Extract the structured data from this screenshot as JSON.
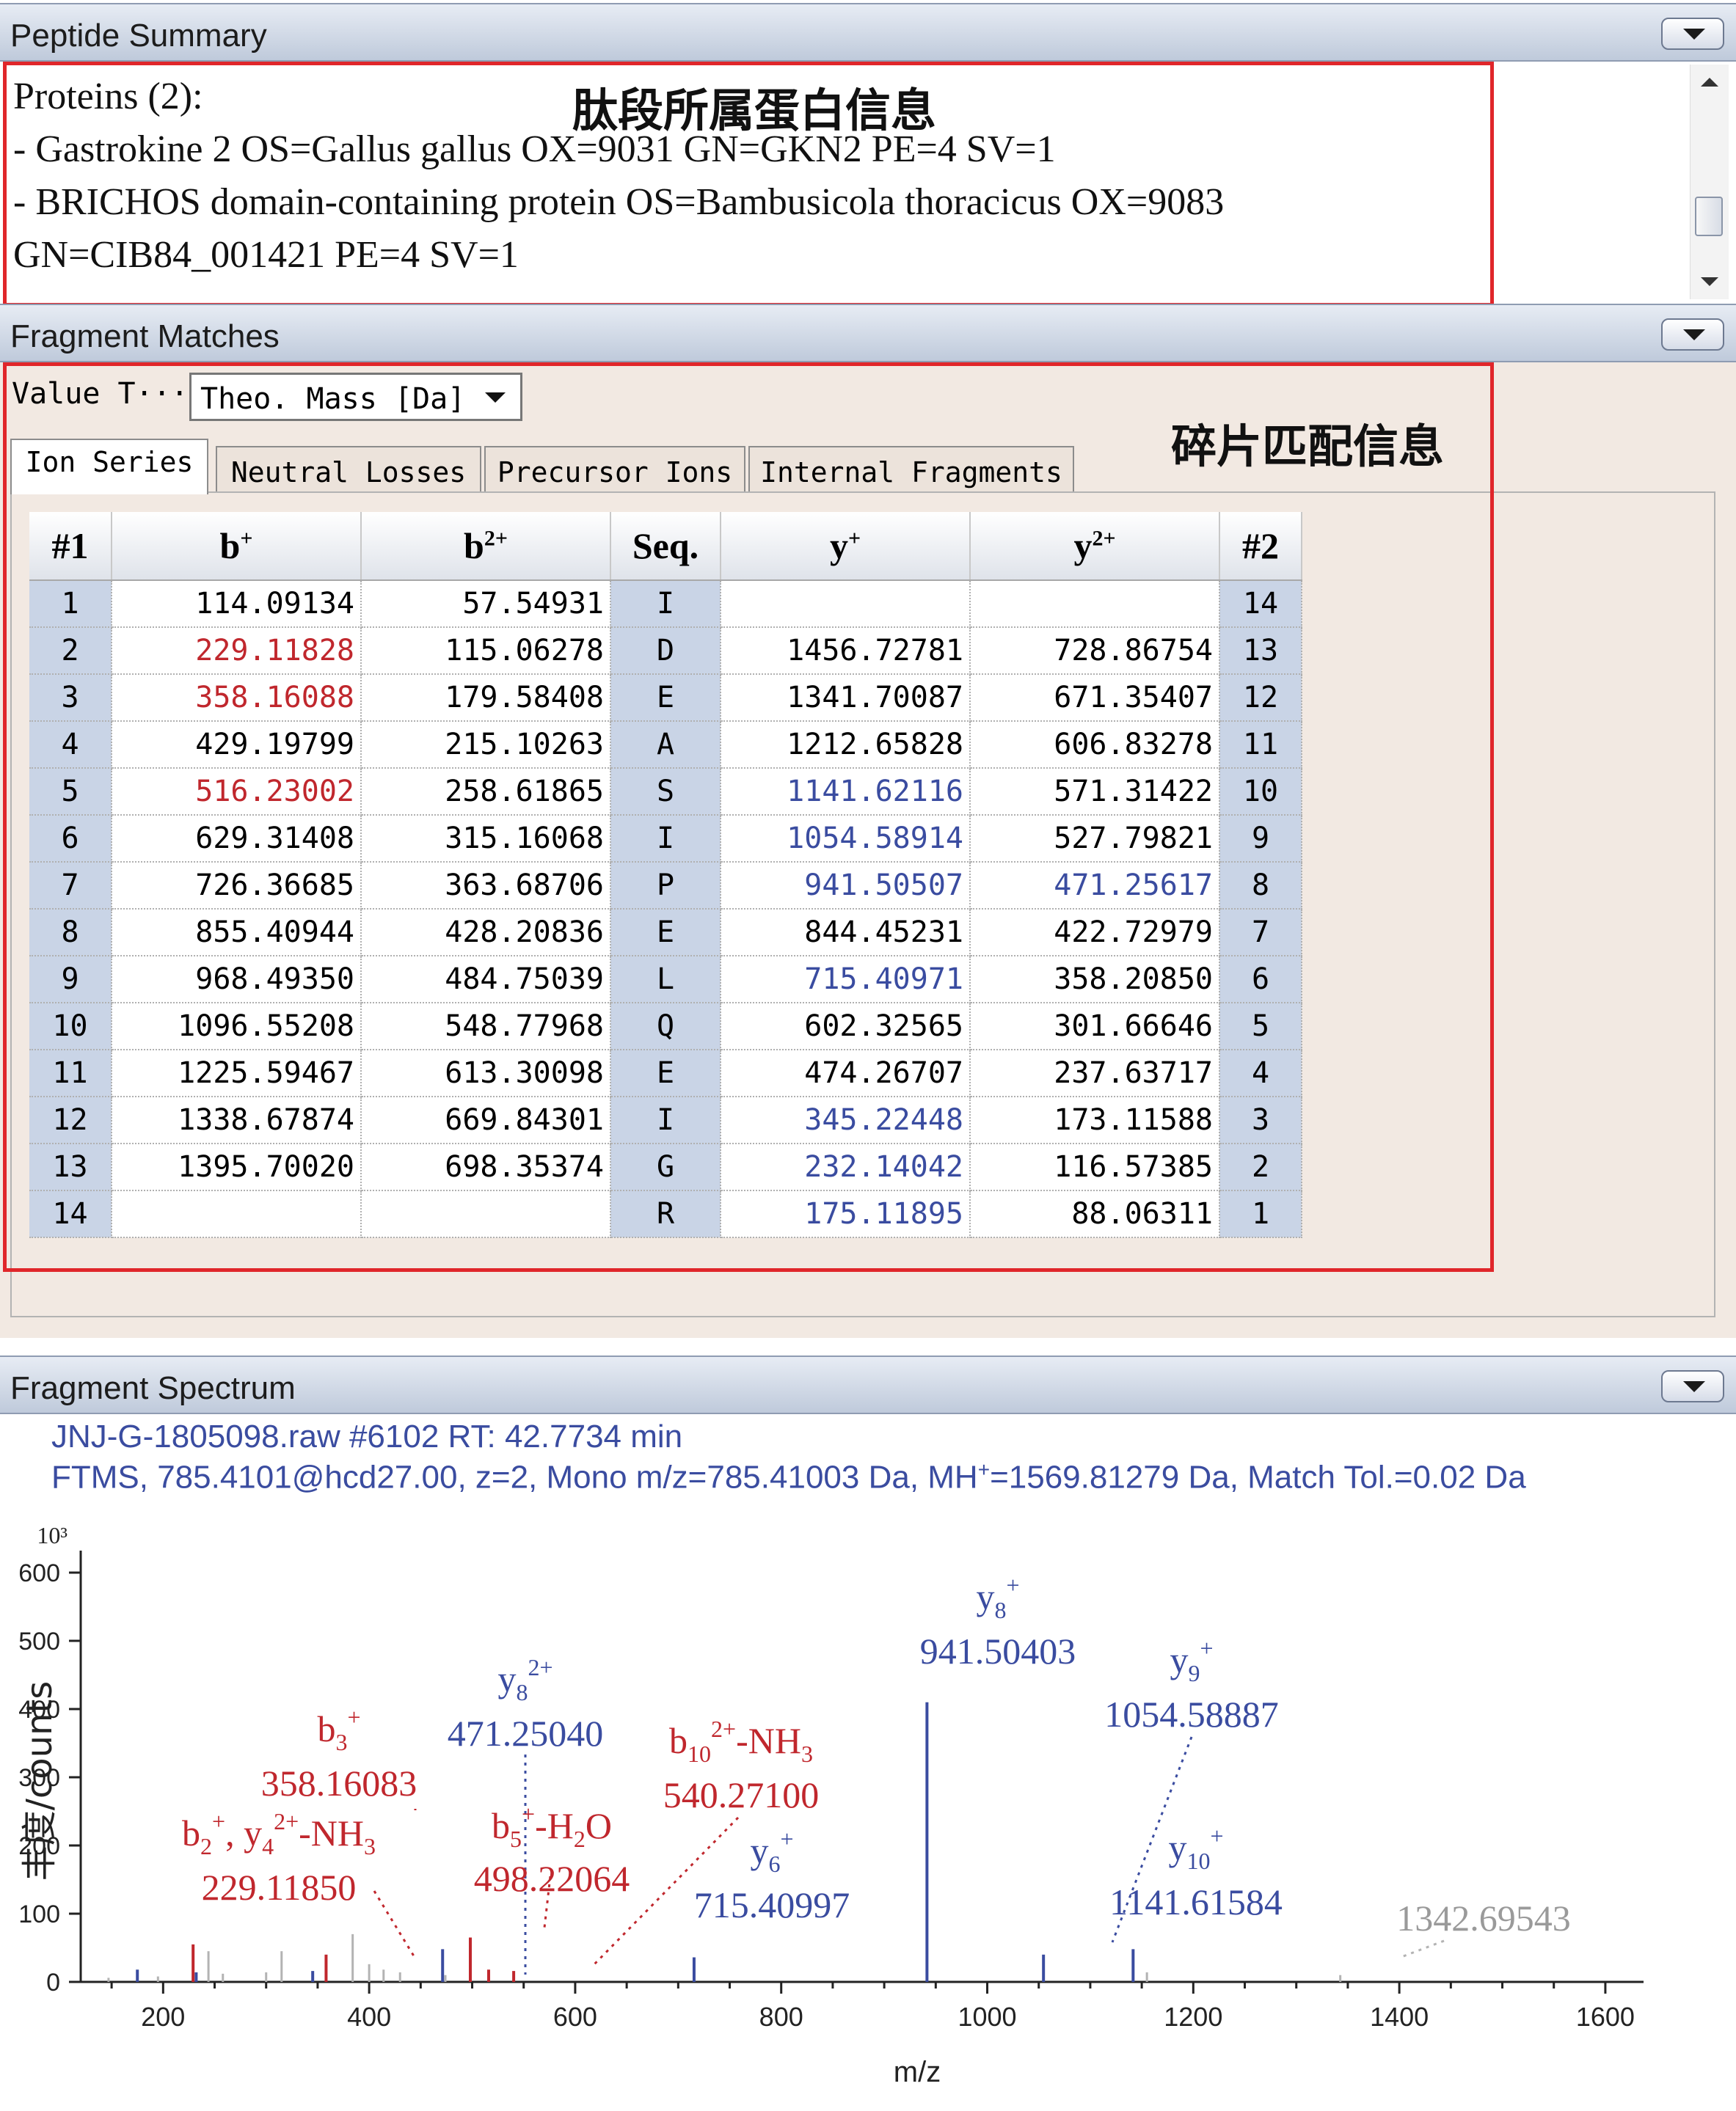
{
  "panels": {
    "summary_title": "Peptide Summary",
    "matches_title": "Fragment Matches",
    "spectrum_title": "Fragment Spectrum"
  },
  "summary": {
    "proteins_header": "Proteins (2):",
    "protein_1": "- Gastrokine 2 OS=Gallus gallus OX=9031 GN=GKN2 PE=4 SV=1",
    "protein_2a": "- BRICHOS domain-containing protein OS=Bambusicola thoracicus OX=9083",
    "protein_2b": "GN=CIB84_001421 PE=4 SV=1",
    "annotation": "肽段所属蛋白信息"
  },
  "matches": {
    "value_type_label": "Value T···",
    "value_type_selected": "Theo. Mass [Da]",
    "annotation": "碎片匹配信息",
    "tabs": [
      "Ion Series",
      "Neutral Losses",
      "Precursor Ions",
      "Internal Fragments"
    ],
    "headers": {
      "n1": "#1",
      "b": "b",
      "b_sup": "+",
      "b2": "b",
      "b2_sup": "2+",
      "seq": "Seq.",
      "y": "y",
      "y_sup": "+",
      "y2": "y",
      "y2_sup": "2+",
      "n2": "#2"
    },
    "rows": [
      {
        "n1": "1",
        "b": "114.09134",
        "b2": "57.54931",
        "seq": "I",
        "y": "",
        "y2": "",
        "n2": "14",
        "bc": "",
        "yc": "",
        "y2c": ""
      },
      {
        "n1": "2",
        "b": "229.11828",
        "b2": "115.06278",
        "seq": "D",
        "y": "1456.72781",
        "y2": "728.86754",
        "n2": "13",
        "bc": "red",
        "yc": "",
        "y2c": ""
      },
      {
        "n1": "3",
        "b": "358.16088",
        "b2": "179.58408",
        "seq": "E",
        "y": "1341.70087",
        "y2": "671.35407",
        "n2": "12",
        "bc": "red",
        "yc": "",
        "y2c": ""
      },
      {
        "n1": "4",
        "b": "429.19799",
        "b2": "215.10263",
        "seq": "A",
        "y": "1212.65828",
        "y2": "606.83278",
        "n2": "11",
        "bc": "",
        "yc": "",
        "y2c": ""
      },
      {
        "n1": "5",
        "b": "516.23002",
        "b2": "258.61865",
        "seq": "S",
        "y": "1141.62116",
        "y2": "571.31422",
        "n2": "10",
        "bc": "red",
        "yc": "blue",
        "y2c": ""
      },
      {
        "n1": "6",
        "b": "629.31408",
        "b2": "315.16068",
        "seq": "I",
        "y": "1054.58914",
        "y2": "527.79821",
        "n2": "9",
        "bc": "",
        "yc": "blue",
        "y2c": ""
      },
      {
        "n1": "7",
        "b": "726.36685",
        "b2": "363.68706",
        "seq": "P",
        "y": "941.50507",
        "y2": "471.25617",
        "n2": "8",
        "bc": "",
        "yc": "blue",
        "y2c": "blue"
      },
      {
        "n1": "8",
        "b": "855.40944",
        "b2": "428.20836",
        "seq": "E",
        "y": "844.45231",
        "y2": "422.72979",
        "n2": "7",
        "bc": "",
        "yc": "",
        "y2c": ""
      },
      {
        "n1": "9",
        "b": "968.49350",
        "b2": "484.75039",
        "seq": "L",
        "y": "715.40971",
        "y2": "358.20850",
        "n2": "6",
        "bc": "",
        "yc": "blue",
        "y2c": ""
      },
      {
        "n1": "10",
        "b": "1096.55208",
        "b2": "548.77968",
        "seq": "Q",
        "y": "602.32565",
        "y2": "301.66646",
        "n2": "5",
        "bc": "",
        "yc": "",
        "y2c": ""
      },
      {
        "n1": "11",
        "b": "1225.59467",
        "b2": "613.30098",
        "seq": "E",
        "y": "474.26707",
        "y2": "237.63717",
        "n2": "4",
        "bc": "",
        "yc": "",
        "y2c": ""
      },
      {
        "n1": "12",
        "b": "1338.67874",
        "b2": "669.84301",
        "seq": "I",
        "y": "345.22448",
        "y2": "173.11588",
        "n2": "3",
        "bc": "",
        "yc": "blue",
        "y2c": ""
      },
      {
        "n1": "13",
        "b": "1395.70020",
        "b2": "698.35374",
        "seq": "G",
        "y": "232.14042",
        "y2": "116.57385",
        "n2": "2",
        "bc": "",
        "yc": "blue",
        "y2c": ""
      },
      {
        "n1": "14",
        "b": "",
        "b2": "",
        "seq": "R",
        "y": "175.11895",
        "y2": "88.06311",
        "n2": "1",
        "bc": "",
        "yc": "blue",
        "y2c": ""
      }
    ]
  },
  "spectrum": {
    "info_line1": "JNJ-G-1805098.raw  #6102  RT: 42.7734 min",
    "info_line2_a": "FTMS, 785.4101@hcd27.00, z=2, Mono m/z=785.41003 Da, MH",
    "info_line2_sup": "+",
    "info_line2_b": "=1569.81279 Da, Match Tol.=0.02 Da",
    "exponent_label": "10³"
  },
  "chart_data": {
    "type": "bar",
    "xlabel": "m/z",
    "ylabel": "丰度/counts",
    "xlim": [
      120,
      1620
    ],
    "ylim": [
      0,
      600
    ],
    "xticks": [
      200,
      400,
      600,
      800,
      1000,
      1200,
      1400,
      1600
    ],
    "yticks": [
      0,
      100,
      200,
      300,
      400,
      500,
      600
    ],
    "colors": {
      "b_ions": "#c0272d",
      "y_ions": "#3a4ca0",
      "unmatched": "#b3b3b3"
    },
    "peaks": [
      {
        "mz": 147,
        "intensity": 6,
        "kind": "gray"
      },
      {
        "mz": 175,
        "intensity": 18,
        "kind": "blue"
      },
      {
        "mz": 195,
        "intensity": 8,
        "kind": "gray"
      },
      {
        "mz": 229.1,
        "intensity": 55,
        "kind": "red"
      },
      {
        "mz": 232.1,
        "intensity": 14,
        "kind": "blue"
      },
      {
        "mz": 244,
        "intensity": 45,
        "kind": "gray"
      },
      {
        "mz": 258,
        "intensity": 12,
        "kind": "gray"
      },
      {
        "mz": 300,
        "intensity": 14,
        "kind": "gray"
      },
      {
        "mz": 315,
        "intensity": 45,
        "kind": "gray"
      },
      {
        "mz": 345.2,
        "intensity": 16,
        "kind": "blue"
      },
      {
        "mz": 358.2,
        "intensity": 40,
        "kind": "red"
      },
      {
        "mz": 384,
        "intensity": 70,
        "kind": "gray"
      },
      {
        "mz": 400,
        "intensity": 26,
        "kind": "gray"
      },
      {
        "mz": 414,
        "intensity": 18,
        "kind": "gray"
      },
      {
        "mz": 430,
        "intensity": 14,
        "kind": "gray"
      },
      {
        "mz": 471.3,
        "intensity": 48,
        "kind": "blue"
      },
      {
        "mz": 474,
        "intensity": 10,
        "kind": "gray"
      },
      {
        "mz": 498.2,
        "intensity": 65,
        "kind": "red"
      },
      {
        "mz": 516,
        "intensity": 18,
        "kind": "red"
      },
      {
        "mz": 540.3,
        "intensity": 16,
        "kind": "red"
      },
      {
        "mz": 715.4,
        "intensity": 36,
        "kind": "blue"
      },
      {
        "mz": 941.5,
        "intensity": 410,
        "kind": "blue"
      },
      {
        "mz": 1054.6,
        "intensity": 40,
        "kind": "blue"
      },
      {
        "mz": 1141.6,
        "intensity": 48,
        "kind": "blue"
      },
      {
        "mz": 1155,
        "intensity": 14,
        "kind": "gray"
      },
      {
        "mz": 1342.7,
        "intensity": 10,
        "kind": "gray"
      }
    ],
    "annotations": [
      {
        "id": "b3",
        "name": "b",
        "sub": "3",
        "sup": "+",
        "value": "358.16083",
        "kind": "red",
        "mz": 358.2,
        "intensity": 40
      },
      {
        "id": "y8_2",
        "name": "y",
        "sub": "8",
        "sup": "2+",
        "value": "471.25040",
        "kind": "blue",
        "mz": 471.3,
        "intensity": 48
      },
      {
        "id": "b10",
        "name": "b",
        "sub": "10",
        "sup": "2+",
        "suffix": "-NH",
        "suffix_sub": "3",
        "value": "540.27100",
        "kind": "red",
        "mz": 540.3,
        "intensity": 16
      },
      {
        "id": "y8",
        "name": "y",
        "sub": "8",
        "sup": "+",
        "value": "941.50403",
        "kind": "blue",
        "mz": 941.5,
        "intensity": 410
      },
      {
        "id": "y9",
        "name": "y",
        "sub": "9",
        "sup": "+",
        "value": "1054.58887",
        "kind": "blue",
        "mz": 1054.6,
        "intensity": 40
      },
      {
        "id": "b2",
        "name": "b",
        "sub": "2",
        "sup": "+",
        "extra": ", y",
        "extra_sub": "4",
        "extra_sup": "2+",
        "suffix": "-NH",
        "suffix_sub": "3",
        "value": "229.11850",
        "kind": "red",
        "mz": 229.1,
        "intensity": 55
      },
      {
        "id": "b5",
        "name": "b",
        "sub": "5",
        "sup": "+",
        "suffix": "-H",
        "suffix_sub": "2",
        "suffix_tail": "O",
        "value": "498.22064",
        "kind": "red",
        "mz": 498.2,
        "intensity": 65
      },
      {
        "id": "y6",
        "name": "y",
        "sub": "6",
        "sup": "+",
        "value": "715.40997",
        "kind": "blue",
        "mz": 715.4,
        "intensity": 36
      },
      {
        "id": "y10",
        "name": "y",
        "sub": "10",
        "sup": "+",
        "value": "1141.61584",
        "kind": "blue",
        "mz": 1141.6,
        "intensity": 48
      },
      {
        "id": "p1342",
        "value": "1342.69543",
        "kind": "gray",
        "mz": 1342.7,
        "intensity": 10
      }
    ]
  }
}
